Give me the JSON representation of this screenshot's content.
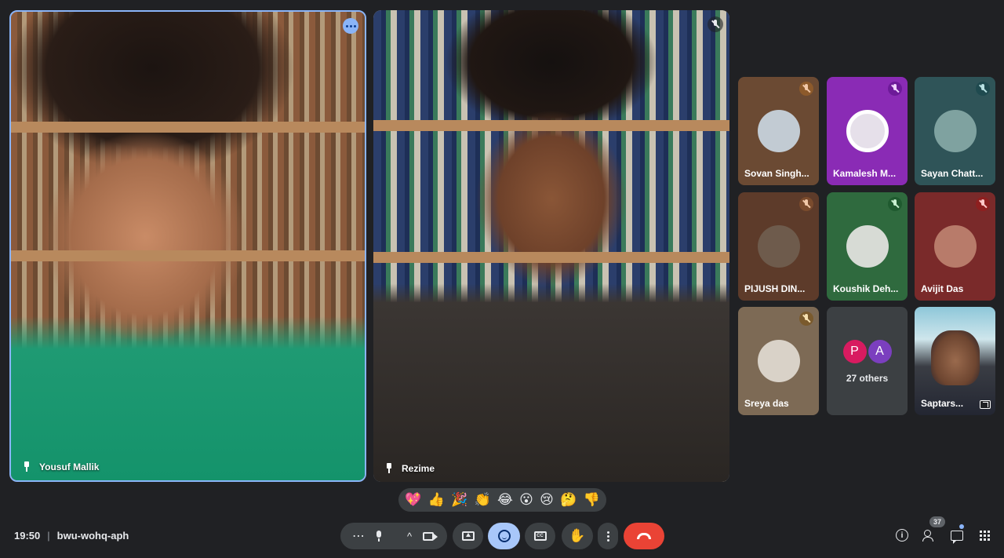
{
  "main_tiles": [
    {
      "name": "Yousuf Mallik",
      "status": "speaking"
    },
    {
      "name": "Rezime",
      "status": "muted"
    }
  ],
  "small_tiles": [
    {
      "name": "Sovan Singh...",
      "bg": "#6b4a33",
      "badge": "#8d5a2b",
      "avatar": "#c2cbd3"
    },
    {
      "name": "Kamalesh M...",
      "bg": "#8a2bb5",
      "badge": "#6d1a99",
      "avatar": "#e6e0ea"
    },
    {
      "name": "Sayan Chatt...",
      "bg": "#2f5458",
      "badge": "#1f4a4f",
      "avatar": "#7fa2a0"
    },
    {
      "name": "PIJUSH DIN...",
      "bg": "#5d3b2a",
      "badge": "#7a4b2d",
      "avatar": "#6e5b4c"
    },
    {
      "name": "Koushik Deh...",
      "bg": "#2f6a3e",
      "badge": "#1f5a2f",
      "avatar": "#d7dbd5"
    },
    {
      "name": "Avijit Das",
      "bg": "#7a2a2a",
      "badge": "#8e1f1f",
      "avatar": "#b87b6a"
    },
    {
      "name": "Sreya das",
      "bg": "#7d6a55",
      "badge": "#7a5a2d",
      "avatar": "#d9d2c8"
    }
  ],
  "others": {
    "initials": [
      "P",
      "A"
    ],
    "colors": [
      "#d81b60",
      "#7b3fbf"
    ],
    "label": "27 others"
  },
  "self_tile": {
    "name": "Saptars..."
  },
  "reactions": [
    "💖",
    "👍",
    "🎉",
    "👏",
    "😂",
    "😮",
    "😢",
    "🤔",
    "👎"
  ],
  "meeting": {
    "time": "19:50",
    "separator": "|",
    "code": "bwu-wohq-aph"
  },
  "controls": {
    "more_label": "⋯",
    "up_label": "^",
    "cc_label": "CC",
    "hand": "✋"
  },
  "people_count": "37",
  "colors": {
    "accent": "#8ab4f8",
    "leave": "#ea4335",
    "emoji_active": "#a8c7fa"
  }
}
